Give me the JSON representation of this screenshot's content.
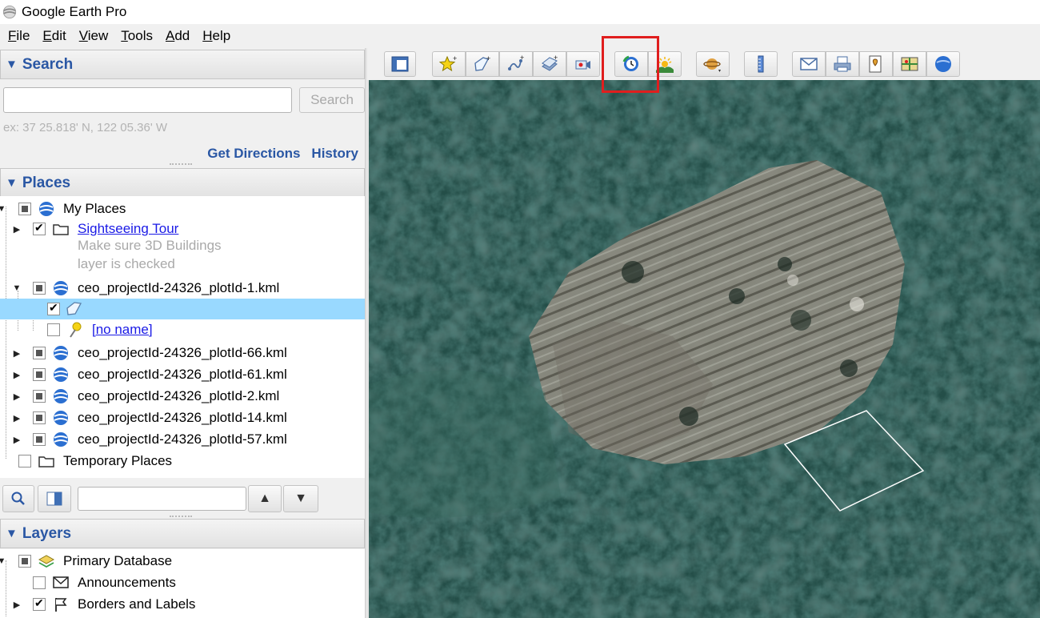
{
  "window": {
    "title": "Google Earth Pro"
  },
  "menu": [
    {
      "key": "F",
      "rest": "ile"
    },
    {
      "key": "E",
      "rest": "dit"
    },
    {
      "key": "V",
      "rest": "iew"
    },
    {
      "key": "T",
      "rest": "ools"
    },
    {
      "key": "A",
      "rest": "dd"
    },
    {
      "key": "H",
      "rest": "elp"
    }
  ],
  "search_panel": {
    "title": "Search",
    "input_value": "",
    "button_label": "Search",
    "hint": "ex: 37 25.818' N, 122 05.36' W",
    "get_directions": "Get Directions",
    "history": "History"
  },
  "places_panel": {
    "title": "Places",
    "my_places": "My Places",
    "sightseeing": "Sightseeing Tour",
    "sightseeing_note_1": "Make sure 3D Buildings",
    "sightseeing_note_2": "layer is checked",
    "kml_1": "ceo_projectId-24326_plotId-1.kml",
    "polygon_name": "",
    "placemark_name": "[no name]",
    "kml_66": "ceo_projectId-24326_plotId-66.kml",
    "kml_61": "ceo_projectId-24326_plotId-61.kml",
    "kml_2": "ceo_projectId-24326_plotId-2.kml",
    "kml_14": "ceo_projectId-24326_plotId-14.kml",
    "kml_57": "ceo_projectId-24326_plotId-57.kml",
    "temporary": "Temporary Places",
    "filter_value": ""
  },
  "layers_panel": {
    "title": "Layers",
    "primary_db": "Primary Database",
    "announcements": "Announcements",
    "borders": "Borders and Labels"
  },
  "toolbar_icons": [
    "sidebar-toggle-icon",
    "add-placemark-icon",
    "add-polygon-icon",
    "add-path-icon",
    "add-image-overlay-icon",
    "record-tour-icon",
    "historical-imagery-icon",
    "sunlight-icon",
    "switch-planet-icon",
    "ruler-icon",
    "email-icon",
    "print-icon",
    "save-image-icon",
    "view-in-maps-icon",
    "earth-icon"
  ],
  "colors": {
    "accent": "#2a57a4",
    "highlight": "#e01e1e",
    "selection": "#99d9ff"
  }
}
